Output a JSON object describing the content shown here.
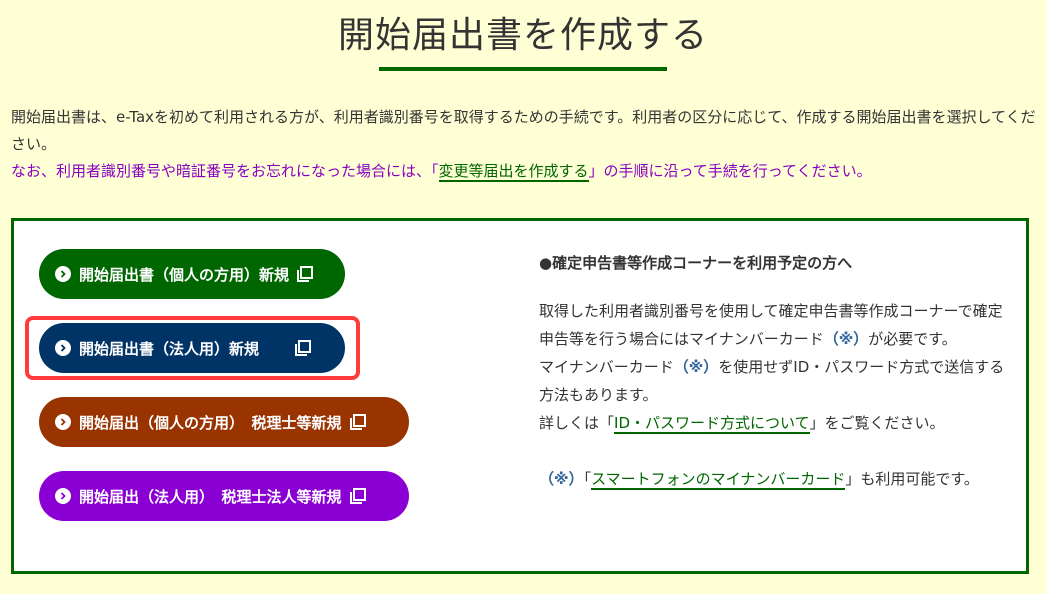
{
  "page": {
    "title": "開始届出書を作成する"
  },
  "intro": {
    "line1": "開始届出書は、e-Taxを初めて利用される方が、利用者識別番号を取得するための手続です。利用者の区分に応じて、作成する開始届出書を選択してください。",
    "notice_before": "なお、利用者識別番号や暗証番号をお忘れになった場合には、「",
    "notice_link": "変更等届出を作成する",
    "notice_after": "」の手順に沿って手続を行ってください。"
  },
  "buttons": [
    {
      "label": "開始届出書（個人の方用）新規",
      "color": "#006600"
    },
    {
      "label": "開始届出書（法人用）新規",
      "color": "#003366"
    },
    {
      "label": "開始届出（個人の方用）　税理士等新規",
      "color": "#993300"
    },
    {
      "label": "開始届出（法人用）　税理士法人等新規",
      "color": "#8a00d4"
    }
  ],
  "info": {
    "heading": "●確定申告書等作成コーナーを利用予定の方へ",
    "para1_before": "取得した利用者識別番号を使用して確定申告書等作成コーナーで確定申告等を行う場合にはマイナンバーカード",
    "para1_mark": "（※）",
    "para1_after": "が必要です。",
    "para2_before": "マイナンバーカード",
    "para2_mark": "（※）",
    "para2_after": "を使用せずID・パスワード方式で送信する方法もあります。",
    "para3_before": "詳しくは「",
    "para3_link": "ID・パスワード方式について",
    "para3_after": "」をご覧ください。",
    "note_mark": "（※）",
    "note_before": "「",
    "note_link": "スマートフォンのマイナンバーカード",
    "note_after": "」も利用可能です。"
  },
  "colors": {
    "background": "#ffffd6",
    "accent_green": "#006600",
    "notice_purple": "#8a00c2",
    "highlight_red": "#ff3b3b"
  },
  "icons": {
    "button_arrow": "chevron-right-circle-icon",
    "button_external": "external-window-icon"
  }
}
